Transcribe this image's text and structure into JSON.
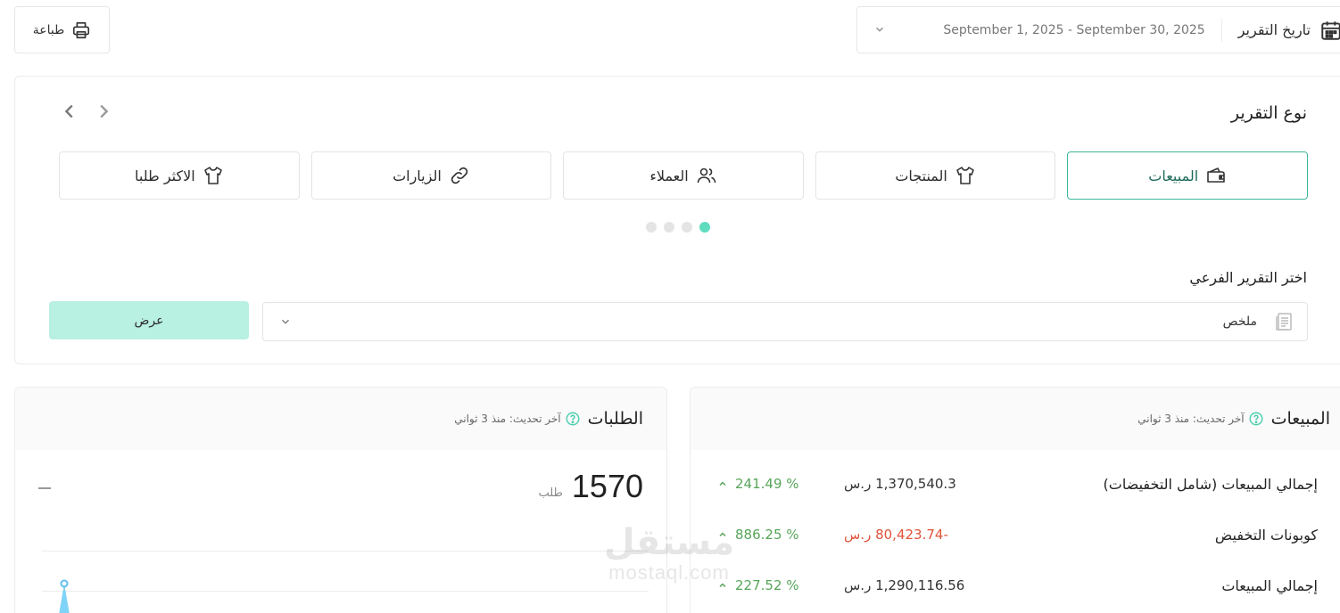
{
  "toolbar": {
    "print_label": "طباعة"
  },
  "date_filter": {
    "title": "تاريخ التقرير",
    "range": "September 1, 2025 - September 30, 2025"
  },
  "report_type": {
    "title": "نوع التقرير",
    "tabs": [
      {
        "label": "المبيعات",
        "icon": "wallet-icon",
        "active": true
      },
      {
        "label": "المنتجات",
        "icon": "shirt-icon",
        "active": false
      },
      {
        "label": "العملاء",
        "icon": "users-icon",
        "active": false
      },
      {
        "label": "الزيارات",
        "icon": "link-icon",
        "active": false
      },
      {
        "label": "الاكثر طلبا",
        "icon": "shirt-icon",
        "active": false
      }
    ],
    "pager_dots": 4,
    "active_dot": 1
  },
  "sub_report": {
    "label": "اختر التقرير الفرعي",
    "selected": "ملخص",
    "show_button": "عرض"
  },
  "orders_panel": {
    "title": "الطلبات",
    "updated": "آخر تحديث: منذ 3 ثواني",
    "count": "1570",
    "unit": "طلب"
  },
  "sales_panel": {
    "title": "المبيعات",
    "updated": "آخر تحديث: منذ 3 ثواني",
    "rows": [
      {
        "label": "إجمالي المبيعات (شامل التخفيضات)",
        "value": "1,370,540.3 ر.س",
        "change": "241.49 %",
        "negative": false
      },
      {
        "label": "كوبونات التخفيض",
        "value": "-80,423.74 ر.س",
        "change": "886.25 %",
        "negative": true
      },
      {
        "label": "إجمالي المبيعات",
        "value": "1,290,116.56 ر.س",
        "change": "227.52 %",
        "negative": false
      }
    ]
  },
  "watermark": {
    "arabic": "مستقل",
    "latin": "mostaql.com"
  },
  "colors": {
    "accent": "#3cb89a",
    "accent_light": "#b8f0e2",
    "dot_active": "#5fdcbd",
    "negative": "#e0523a",
    "positive": "#58a55a"
  }
}
